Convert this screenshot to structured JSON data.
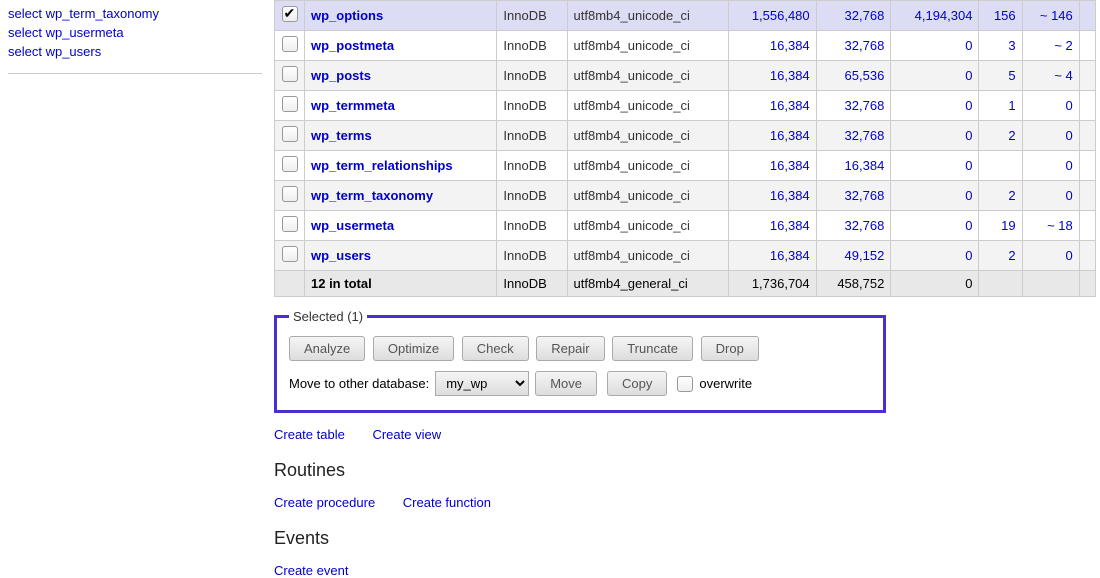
{
  "sidebar": {
    "items": [
      {
        "label": "select wp_term_taxonomy"
      },
      {
        "label": "select wp_usermeta"
      },
      {
        "label": "select wp_users"
      }
    ]
  },
  "table": {
    "rows": [
      {
        "checked": true,
        "selected": true,
        "name": "wp_options",
        "engine": "InnoDB",
        "collation": "utf8mb4_unicode_ci",
        "c1": "1,556,480",
        "c2": "32,768",
        "c3": "4,194,304",
        "c4": "156",
        "c5": "~ 146"
      },
      {
        "checked": false,
        "name": "wp_postmeta",
        "engine": "InnoDB",
        "collation": "utf8mb4_unicode_ci",
        "c1": "16,384",
        "c2": "32,768",
        "c3": "0",
        "c4": "3",
        "c5": "~ 2"
      },
      {
        "checked": false,
        "name": "wp_posts",
        "engine": "InnoDB",
        "collation": "utf8mb4_unicode_ci",
        "c1": "16,384",
        "c2": "65,536",
        "c3": "0",
        "c4": "5",
        "c5": "~ 4"
      },
      {
        "checked": false,
        "name": "wp_termmeta",
        "engine": "InnoDB",
        "collation": "utf8mb4_unicode_ci",
        "c1": "16,384",
        "c2": "32,768",
        "c3": "0",
        "c4": "1",
        "c5": "0"
      },
      {
        "checked": false,
        "name": "wp_terms",
        "engine": "InnoDB",
        "collation": "utf8mb4_unicode_ci",
        "c1": "16,384",
        "c2": "32,768",
        "c3": "0",
        "c4": "2",
        "c5": "0"
      },
      {
        "checked": false,
        "name": "wp_term_relationships",
        "engine": "InnoDB",
        "collation": "utf8mb4_unicode_ci",
        "c1": "16,384",
        "c2": "16,384",
        "c3": "0",
        "c4": "",
        "c5": "0"
      },
      {
        "checked": false,
        "name": "wp_term_taxonomy",
        "engine": "InnoDB",
        "collation": "utf8mb4_unicode_ci",
        "c1": "16,384",
        "c2": "32,768",
        "c3": "0",
        "c4": "2",
        "c5": "0"
      },
      {
        "checked": false,
        "name": "wp_usermeta",
        "engine": "InnoDB",
        "collation": "utf8mb4_unicode_ci",
        "c1": "16,384",
        "c2": "32,768",
        "c3": "0",
        "c4": "19",
        "c5": "~ 18"
      },
      {
        "checked": false,
        "name": "wp_users",
        "engine": "InnoDB",
        "collation": "utf8mb4_unicode_ci",
        "c1": "16,384",
        "c2": "49,152",
        "c3": "0",
        "c4": "2",
        "c5": "0"
      }
    ],
    "total": {
      "label": "12 in total",
      "engine": "InnoDB",
      "collation": "utf8mb4_general_ci",
      "c1": "1,736,704",
      "c2": "458,752",
      "c3": "0"
    }
  },
  "selected": {
    "legend": "Selected (1)",
    "buttons": {
      "analyze": "Analyze",
      "optimize": "Optimize",
      "check": "Check",
      "repair": "Repair",
      "truncate": "Truncate",
      "drop": "Drop"
    },
    "move_label": "Move to other database:",
    "db_value": "my_wp",
    "move": "Move",
    "copy": "Copy",
    "overwrite": "overwrite"
  },
  "links": {
    "create_table": "Create table",
    "create_view": "Create view"
  },
  "routines": {
    "heading": "Routines",
    "create_procedure": "Create procedure",
    "create_function": "Create function"
  },
  "events": {
    "heading": "Events",
    "create_event": "Create event"
  }
}
